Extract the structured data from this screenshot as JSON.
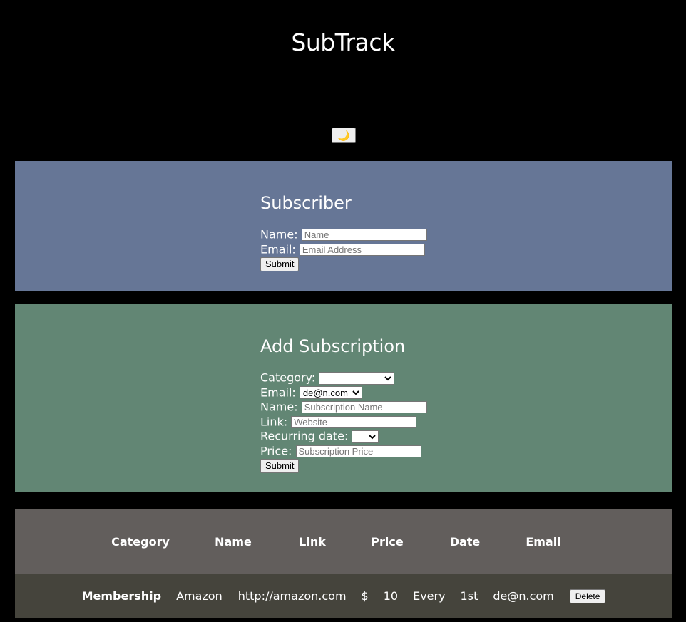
{
  "app": {
    "title": "SubTrack",
    "theme_toggle_icon": "🌙"
  },
  "subscriber_form": {
    "title": "Subscriber",
    "name_label": "Name:",
    "name_placeholder": "Name",
    "email_label": "Email:",
    "email_placeholder": "Email Address",
    "submit_label": "Submit"
  },
  "subscription_form": {
    "title": "Add Subscription",
    "category_label": "Category:",
    "category_value": "",
    "email_label": "Email:",
    "email_value": "de@n.com",
    "name_label": "Name:",
    "name_placeholder": "Subscription Name",
    "link_label": "Link:",
    "link_placeholder": "Website",
    "recurring_label": "Recurring date:",
    "recurring_value": "",
    "price_label": "Price:",
    "price_placeholder": "Subscription Price",
    "submit_label": "Submit"
  },
  "table": {
    "headers": [
      "Category",
      "Name",
      "Link",
      "Price",
      "Date",
      "Email"
    ],
    "rows": [
      {
        "category": "Membership",
        "name": "Amazon",
        "link": "http://amazon.com",
        "currency": "$",
        "price": "10",
        "every": "Every",
        "date": "1st",
        "email": "de@n.com",
        "delete_label": "Delete"
      }
    ]
  },
  "colors": {
    "background": "#000000",
    "subscriber_panel": "#667696",
    "subscription_panel": "#628674",
    "table_header": "#625e5c",
    "table_row": "#45443c"
  }
}
